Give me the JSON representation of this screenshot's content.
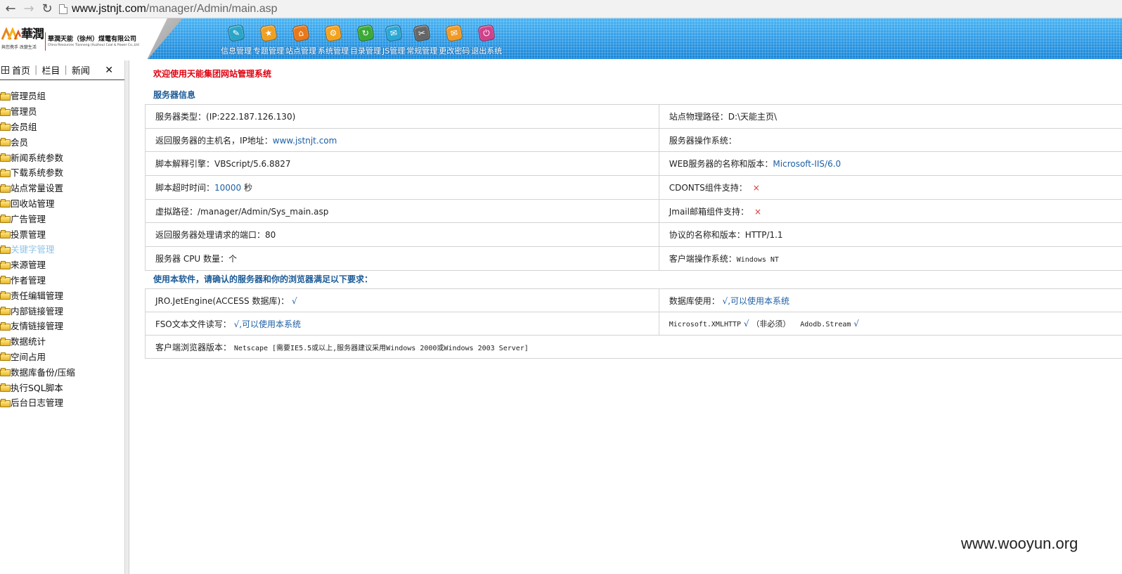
{
  "browser": {
    "url_host": "www.jstnjt.com",
    "url_path": "/manager/Admin/main.asp"
  },
  "header": {
    "logo_cn": "華潤",
    "logo_slogan": "與您携手 改變生活",
    "company_cn": "華潤天能（徐州）煤電有限公司",
    "company_en": "China Resources Tianneng (Xuzhou) Coal & Power Co.,Ltd",
    "nav": [
      {
        "label": "信息管理",
        "icon": "info-icon",
        "color": "#2aa5c8"
      },
      {
        "label": "专题管理",
        "icon": "topic-icon",
        "color": "#f0a020"
      },
      {
        "label": "站点管理",
        "icon": "site-icon",
        "color": "#e8781a"
      },
      {
        "label": "系统管理",
        "icon": "system-icon",
        "color": "#f4a21c"
      },
      {
        "label": "目录管理",
        "icon": "directory-icon",
        "color": "#3aaa35"
      },
      {
        "label": "JS管理",
        "icon": "js-icon",
        "color": "#29a7d6"
      },
      {
        "label": "常规管理",
        "icon": "regular-icon",
        "color": "#666666"
      },
      {
        "label": "更改密码",
        "icon": "password-icon",
        "color": "#f09a26"
      },
      {
        "label": "退出系统",
        "icon": "exit-icon",
        "color": "#d0418a"
      }
    ]
  },
  "sidebar": {
    "tabs": [
      "首页",
      "栏目",
      "新闻"
    ],
    "close": "✕",
    "items": [
      "管理员组",
      "管理员",
      "会员组",
      "会员",
      "新闻系统参数",
      "下载系统参数",
      "站点常量设置",
      "回收站管理",
      "广告管理",
      "投票管理",
      "关键字管理",
      "来源管理",
      "作者管理",
      "责任编辑管理",
      "内部链接管理",
      "友情链接管理",
      "数据统计",
      "空间占用",
      "数据库备份/压缩",
      "执行SQL脚本",
      "后台日志管理"
    ],
    "active_index": 10
  },
  "main": {
    "welcome": "欢迎使用天能集团网站管理系统",
    "server_title": "服务器信息",
    "server_rows": [
      {
        "l_label": "服务器类型：",
        "l_value": "(IP:222.187.126.130)",
        "r_label": "站点物理路径：",
        "r_value": "D:\\天能主页\\"
      },
      {
        "l_label": "返回服务器的主机名，IP地址：",
        "l_value": "www.jstnjt.com",
        "r_label": "服务器操作系统：",
        "r_value": ""
      },
      {
        "l_label": "脚本解释引擎：",
        "l_value": "VBScript/5.6.8827",
        "r_label": "WEB服务器的名称和版本：",
        "r_value": "Microsoft-IIS/6.0"
      },
      {
        "l_label": "脚本超时时间：",
        "l_value": "10000",
        "l_suffix": " 秒",
        "r_label": "CDONTS组件支持：",
        "r_value": "×"
      },
      {
        "l_label": "虚拟路径：",
        "l_value": "/manager/Admin/Sys_main.asp",
        "r_label": "Jmail邮箱组件支持：",
        "r_value": "×"
      },
      {
        "l_label": "返回服务器处理请求的端口：",
        "l_value": "80",
        "r_label": "协议的名称和版本：",
        "r_value": "HTTP/1.1"
      },
      {
        "l_label": "服务器 CPU 数量：",
        "l_value": "个",
        "r_label": "客户端操作系统：",
        "r_value": "Windows NT"
      }
    ],
    "req_title": "使用本软件，请确认的服务器和你的浏览器满足以下要求：",
    "req_rows": [
      {
        "l_label": "JRO.JetEngine(ACCESS 数据库)：",
        "l_value": "√",
        "r_label": "数据库使用：",
        "r_value": "√,可以使用本系统"
      },
      {
        "l_label": "FSO文本文件读写：",
        "l_value": "√,可以使用本系统",
        "r_label": "Microsoft.XMLHTTP",
        "r_value": "√",
        "r_note": "（非必须）",
        "r_label2": "Adodb.Stream",
        "r_value2": "√"
      }
    ],
    "browser_row": {
      "label": "客户端浏览器版本：",
      "value": "Netscape [需要IE5.5或以上,服务器建议采用Windows 2000或Windows 2003 Server]"
    }
  },
  "watermark": "www.wooyun.org"
}
